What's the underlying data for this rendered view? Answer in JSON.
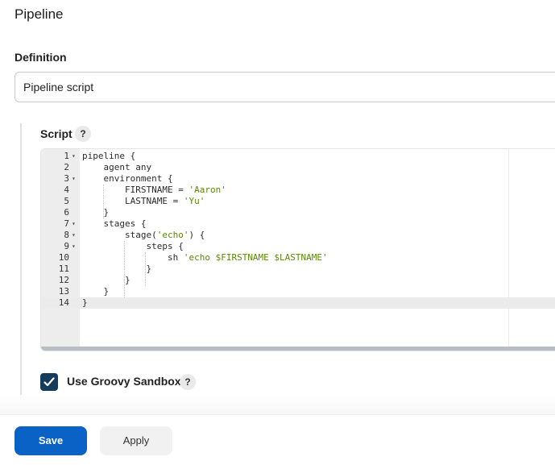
{
  "pipeline": {
    "title": "Pipeline",
    "definition_label": "Definition",
    "definition_value": "Pipeline script"
  },
  "script": {
    "label": "Script",
    "help": "?",
    "lines": [
      {
        "num": "1",
        "fold": "▾",
        "code": "pipeline {"
      },
      {
        "num": "2",
        "fold": "",
        "code": "    agent any"
      },
      {
        "num": "3",
        "fold": "▾",
        "code": "    environment {"
      },
      {
        "num": "4",
        "fold": "",
        "code": "        FIRSTNAME = 'Aaron'"
      },
      {
        "num": "5",
        "fold": "",
        "code": "        LASTNAME = 'Yu'"
      },
      {
        "num": "6",
        "fold": "",
        "code": "    }"
      },
      {
        "num": "7",
        "fold": "▾",
        "code": "    stages {"
      },
      {
        "num": "8",
        "fold": "▾",
        "code": "        stage('echo') {"
      },
      {
        "num": "9",
        "fold": "▾",
        "code": "            steps {"
      },
      {
        "num": "10",
        "fold": "",
        "code": "                sh 'echo $FIRSTNAME $LASTNAME'"
      },
      {
        "num": "11",
        "fold": "",
        "code": "            }"
      },
      {
        "num": "12",
        "fold": "",
        "code": "        }"
      },
      {
        "num": "13",
        "fold": "",
        "code": "    }"
      },
      {
        "num": "14",
        "fold": "",
        "code": "}"
      }
    ],
    "active_line": 14
  },
  "sandbox": {
    "label": "Use Groovy Sandbox",
    "checked": true,
    "help": "?"
  },
  "actions": {
    "save_label": "Save",
    "apply_label": "Apply"
  },
  "colors": {
    "primary": "#0b62c6",
    "checkbox": "#163c5c",
    "string": "#5a8a00"
  }
}
